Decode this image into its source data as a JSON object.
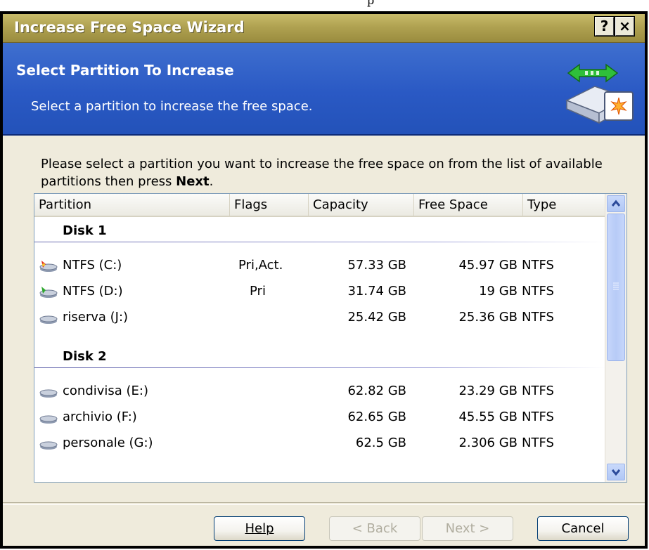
{
  "window": {
    "title": "Increase Free Space Wizard",
    "help_glyph": "?",
    "close_glyph": "×"
  },
  "header": {
    "title": "Select Partition To Increase",
    "subtitle": "Select a partition to increase the free space."
  },
  "instructions": {
    "text_before": "Please select a partition you want to increase the free space on from the list of available partitions then press ",
    "bold": "Next",
    "text_after": "."
  },
  "list": {
    "columns": [
      "Partition",
      "Flags",
      "Capacity",
      "Free Space",
      "Type"
    ],
    "disks": [
      {
        "label": "Disk 1",
        "partitions": [
          {
            "name": "NTFS (C:)",
            "flags": "Pri,Act.",
            "capacity": "57.33 GB",
            "free": "45.97 GB",
            "type": "NTFS",
            "icon": "partition-active-icon"
          },
          {
            "name": "NTFS (D:)",
            "flags": "Pri",
            "capacity": "31.74 GB",
            "free": "19 GB",
            "type": "NTFS",
            "icon": "partition-primary-icon"
          },
          {
            "name": "riserva (J:)",
            "flags": "",
            "capacity": "25.42 GB",
            "free": "25.36 GB",
            "type": "NTFS",
            "icon": "partition-icon"
          }
        ]
      },
      {
        "label": "Disk 2",
        "partitions": [
          {
            "name": "condivisa (E:)",
            "flags": "",
            "capacity": "62.82 GB",
            "free": "23.29 GB",
            "type": "NTFS",
            "icon": "partition-icon"
          },
          {
            "name": "archivio (F:)",
            "flags": "",
            "capacity": "62.65 GB",
            "free": "45.55 GB",
            "type": "NTFS",
            "icon": "partition-icon"
          },
          {
            "name": "personale (G:)",
            "flags": "",
            "capacity": "62.5 GB",
            "free": "2.306 GB",
            "type": "NTFS",
            "icon": "partition-icon"
          }
        ]
      }
    ]
  },
  "buttons": {
    "help": "Help",
    "back": "< Back",
    "next": "Next >",
    "cancel": "Cancel"
  },
  "top_fragment": "p"
}
